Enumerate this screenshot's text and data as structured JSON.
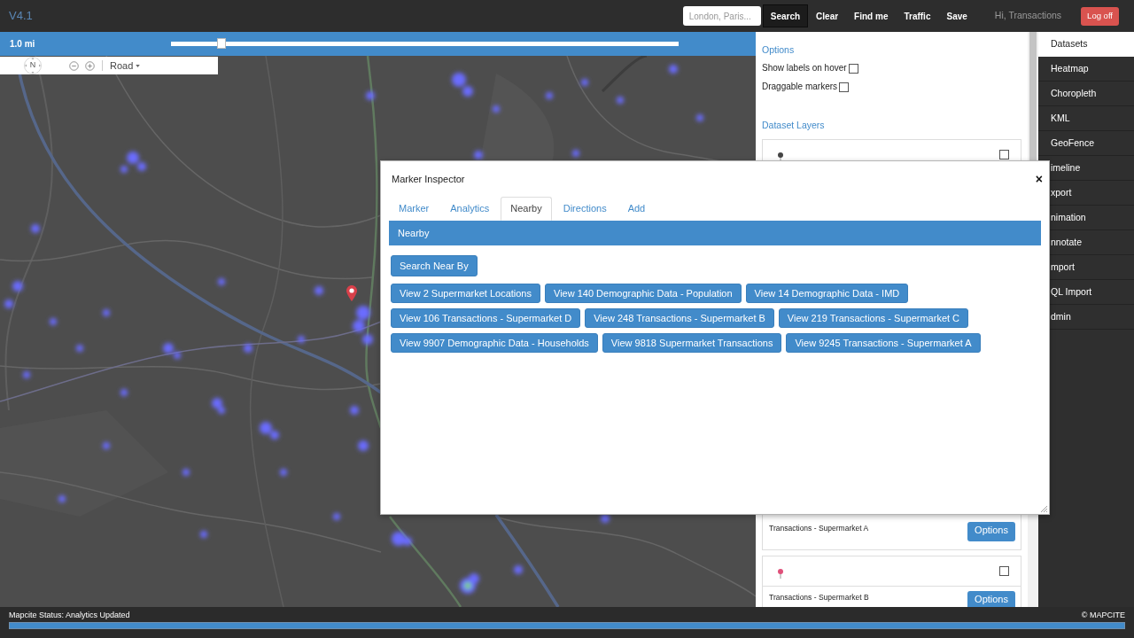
{
  "app": {
    "version": "V4.1"
  },
  "topbar": {
    "search": {
      "placeholder": "London, Paris..."
    },
    "buttons": [
      {
        "label": "Search",
        "selected": true
      },
      {
        "label": "Clear",
        "selected": false
      },
      {
        "label": "Find me",
        "selected": false
      },
      {
        "label": "Traffic",
        "selected": false
      },
      {
        "label": "Save",
        "selected": false
      }
    ],
    "greeting": "Hi, Transactions",
    "logout": "Log off"
  },
  "radius": {
    "label": "1.0 mi",
    "level": 0.1
  },
  "map_controls": {
    "compass": "N",
    "map_type": "Road"
  },
  "options": {
    "title": "Options",
    "settings": [
      {
        "label": "Show labels on hover",
        "checked": false
      },
      {
        "label": "Draggable markers",
        "checked": false
      }
    ],
    "layers_title": "Dataset Layers",
    "layers": [
      {
        "color": "#444444",
        "checked": false,
        "name": "Transactions - Supermarket A",
        "button": "Options"
      },
      {
        "color": "#e0507a",
        "checked": false,
        "name": "Transactions - Supermarket B",
        "button": "Options"
      }
    ]
  },
  "sidebar": {
    "items": [
      {
        "label": "Datasets",
        "selected": true
      },
      {
        "label": "Heatmap",
        "selected": false
      },
      {
        "label": "Choropleth",
        "selected": false
      },
      {
        "label": "KML",
        "selected": false
      },
      {
        "label": "GeoFence",
        "selected": false
      },
      {
        "label": "imeline",
        "selected": false
      },
      {
        "label": "xport",
        "selected": false
      },
      {
        "label": "nimation",
        "selected": false
      },
      {
        "label": "nnotate",
        "selected": false
      },
      {
        "label": "mport",
        "selected": false
      },
      {
        "label": "QL Import",
        "selected": false
      },
      {
        "label": "dmin",
        "selected": false
      }
    ]
  },
  "modal": {
    "title": "Marker Inspector",
    "close": "×",
    "tabs": [
      {
        "label": "Marker",
        "selected": false
      },
      {
        "label": "Analytics",
        "selected": false
      },
      {
        "label": "Nearby",
        "selected": true
      },
      {
        "label": "Directions",
        "selected": false
      },
      {
        "label": "Add",
        "selected": false
      }
    ],
    "section": "Nearby",
    "search_button": "Search Near By",
    "result_rows": [
      [
        "View 2 Supermarket Locations",
        "View 140 Demographic Data - Population",
        "View 14 Demographic Data - IMD"
      ],
      [
        "View 106 Transactions - Supermarket D",
        "View 248 Transactions - Supermarket B",
        "View 219 Transactions - Supermarket C"
      ],
      [
        "View 9907 Demographic Data - Households",
        "View 9818 Supermarket Transactions",
        "View 9245 Transactions - Supermarket A"
      ]
    ]
  },
  "status_bar": {
    "text": "Mapcite Status: Analytics Updated",
    "copyright": "© MAPCITE",
    "progress": {
      "level": 1
    }
  }
}
